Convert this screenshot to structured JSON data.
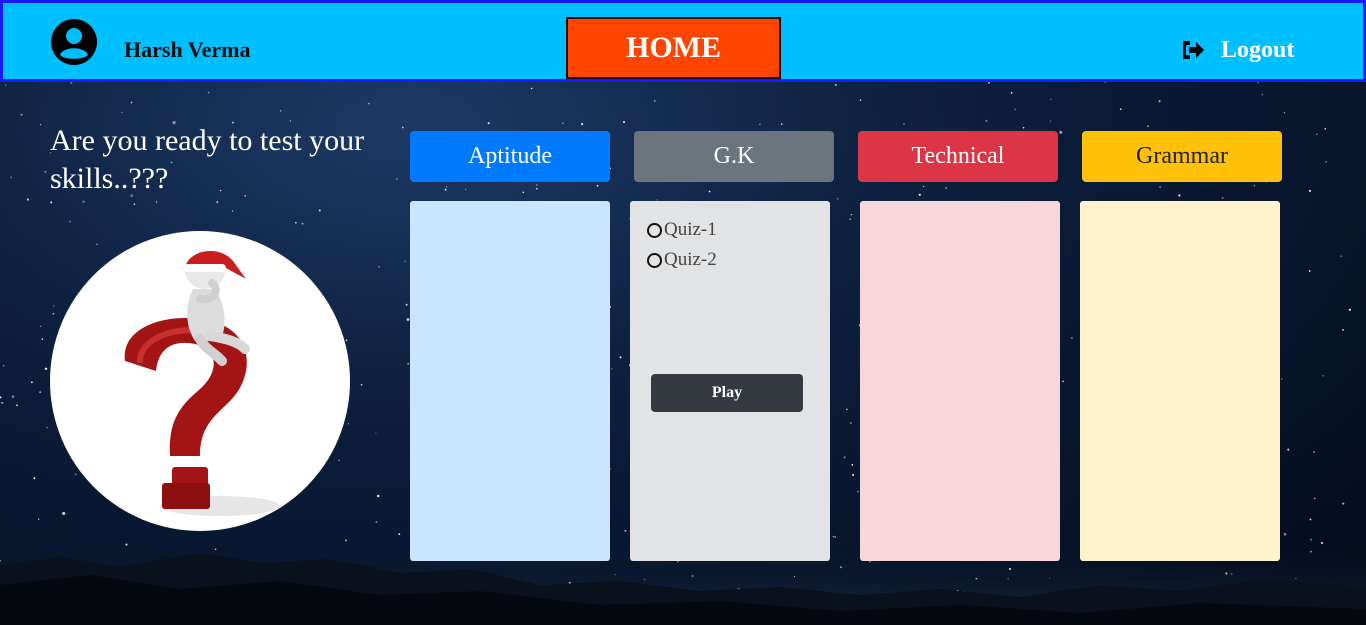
{
  "navbar": {
    "user_name": "Harsh Verma",
    "home_label": "HOME",
    "logout_label": "Logout",
    "bg_color": "#00bfff",
    "home_color": "#ff4500"
  },
  "hero": {
    "tagline": "Are you ready to test your skills..???"
  },
  "categories": [
    {
      "label": "Aptitude",
      "color": "#007bff",
      "panel_color": "#cce5ff"
    },
    {
      "label": "G.K",
      "color": "#6c757d",
      "panel_color": "#e2e3e5"
    },
    {
      "label": "Technical",
      "color": "#dc3545",
      "panel_color": "#f8d7da"
    },
    {
      "label": "Grammar",
      "color": "#ffc107",
      "panel_color": "#fff3cd"
    }
  ],
  "gk_panel": {
    "quizzes": [
      "Quiz-1",
      "Quiz-2"
    ],
    "play_label": "Play"
  },
  "icons": {
    "user": "user-circle-icon",
    "logout": "sign-out-icon"
  }
}
